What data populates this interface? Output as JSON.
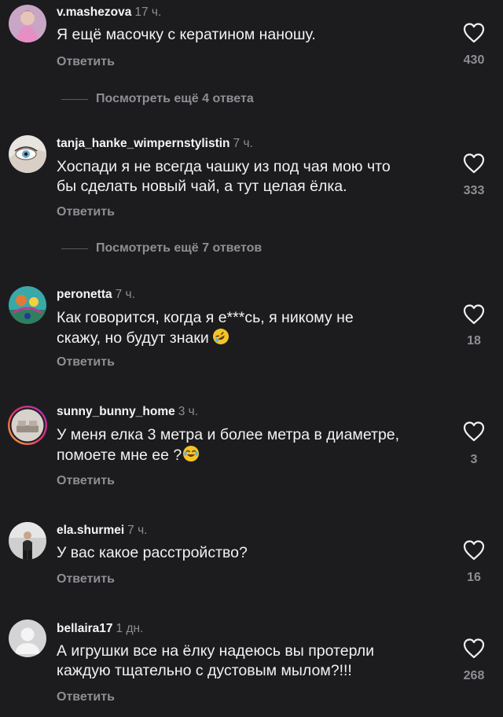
{
  "comments": [
    {
      "username": "v.mashezova",
      "time": "17 ч.",
      "text_lines": [
        "Я ещё масочку  с кератином наношу."
      ],
      "reply_label": "Ответить",
      "likes": "430"
    },
    {
      "username": "tanja_hanke_wimpernstylistin",
      "time": "7 ч.",
      "text_lines": [
        "Хоспади я не всегда чашку из под чая мою что",
        "бы сделать новый чай, а тут целая ёлка."
      ],
      "reply_label": "Ответить",
      "likes": "333"
    },
    {
      "username": "peronetta",
      "time": "7 ч.",
      "text_lines": [
        "Как говорится, когда я е***сь, я никому не",
        "скажу, но будут знаки"
      ],
      "reply_label": "Ответить",
      "likes": "18"
    },
    {
      "username": "sunny_bunny_home",
      "time": "3 ч.",
      "text_lines": [
        "У меня елка 3 метра и более метра в диаметре,",
        "помоете мне ее ?"
      ],
      "reply_label": "Ответить",
      "likes": "3"
    },
    {
      "username": "ela.shurmei",
      "time": "7 ч.",
      "text_lines": [
        "У вас какое расстройство?"
      ],
      "reply_label": "Ответить",
      "likes": "16"
    },
    {
      "username": "bellaira17",
      "time": "1 дн.",
      "text_lines": [
        "А игрушки все на ёлку надеюсь вы протерли",
        "каждую тщательно с дустовым мылом?!!!"
      ],
      "reply_label": "Ответить",
      "likes": "268"
    }
  ],
  "view_more": [
    {
      "label": "Посмотреть ещё 4 ответа"
    },
    {
      "label": "Посмотреть ещё 7 ответов"
    }
  ],
  "icons": {
    "like": "heart-outline-icon",
    "emoji_laughing": "rolling-on-floor-laughing-emoji",
    "emoji_tears": "tears-of-joy-emoji"
  },
  "colors": {
    "background": "#1c1c1e",
    "text": "#f2f2f2",
    "secondary": "#8e8e93"
  }
}
